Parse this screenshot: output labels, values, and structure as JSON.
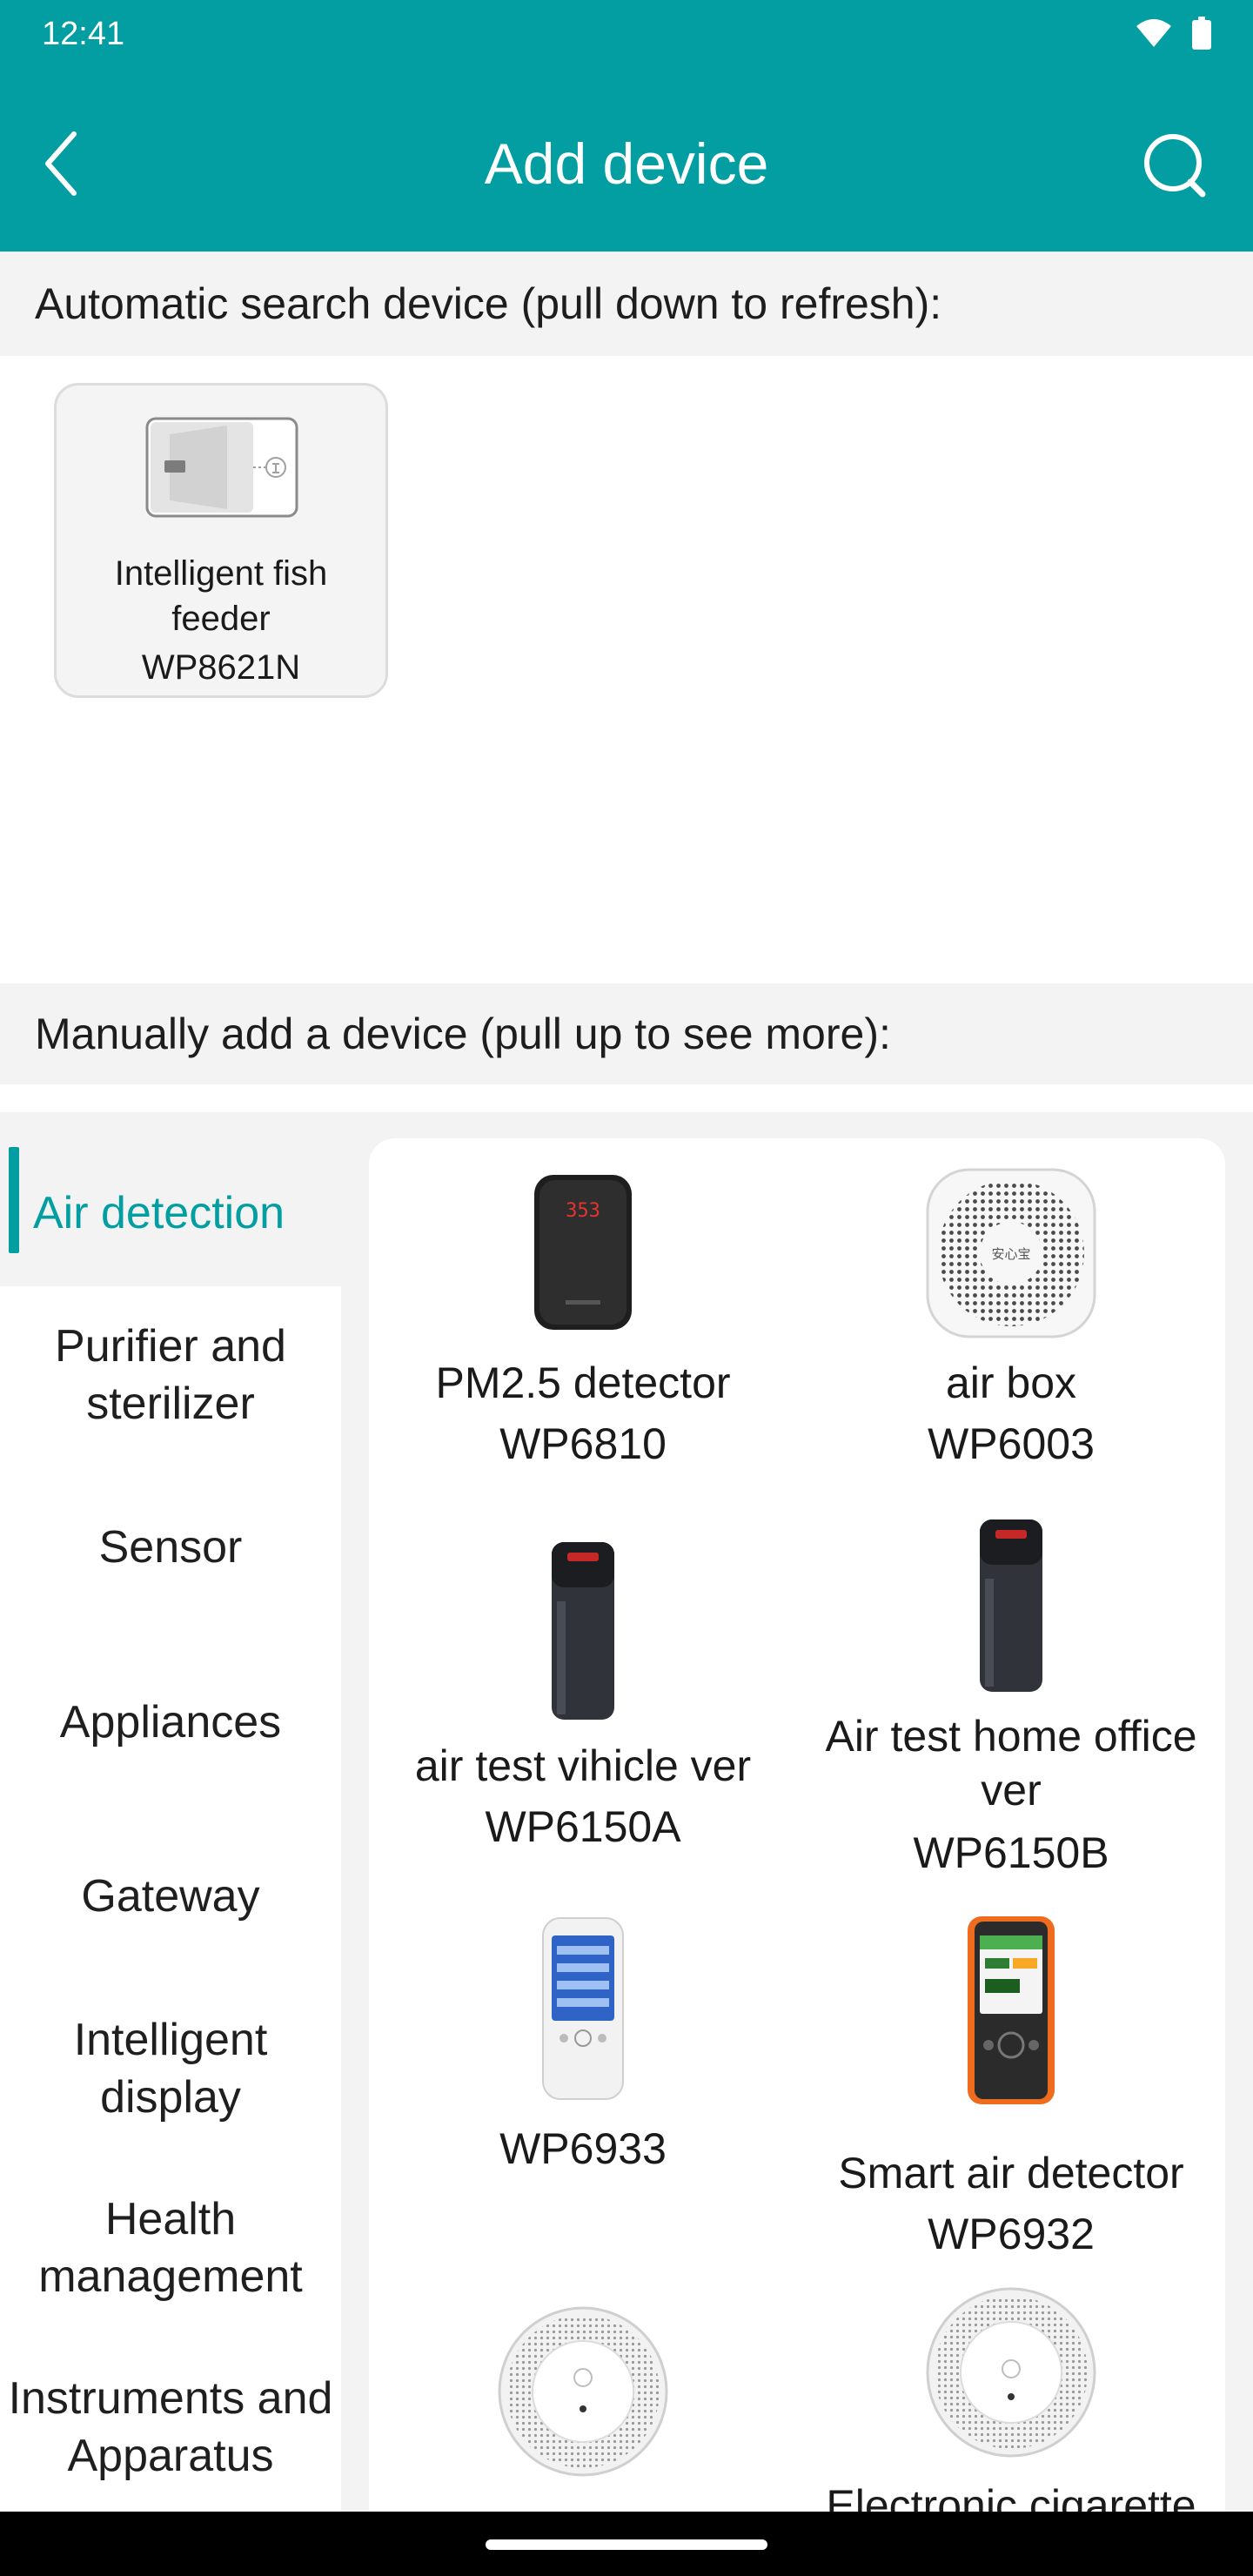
{
  "status_bar": {
    "time": "12:41"
  },
  "header": {
    "title": "Add device"
  },
  "auto_section": {
    "heading": "Automatic search device (pull down to refresh):",
    "devices": [
      {
        "name": "Intelligent fish feeder",
        "model": "WP8621N"
      }
    ]
  },
  "manual_section": {
    "heading": "Manually add a device (pull up to see more):",
    "categories": [
      {
        "label": "Air detection",
        "active": true
      },
      {
        "label": "Purifier and sterilizer"
      },
      {
        "label": "Sensor"
      },
      {
        "label": "Appliances"
      },
      {
        "label": "Gateway"
      },
      {
        "label": "Intelligent display"
      },
      {
        "label": "Health management"
      },
      {
        "label": "Instruments and Apparatus"
      }
    ],
    "products": [
      {
        "name": "PM2.5 detector",
        "model": "WP6810",
        "icon": "pm25-detector-image"
      },
      {
        "name": "air box",
        "model": "WP6003",
        "icon": "air-box-image"
      },
      {
        "name": "air test vihicle ver",
        "model": "WP6150A",
        "icon": "air-test-vehicle-image"
      },
      {
        "name": "Air test home office ver",
        "model": "WP6150B",
        "icon": "air-test-home-office-image"
      },
      {
        "name": "",
        "model": "WP6933",
        "icon": "wp6933-image"
      },
      {
        "name": "Smart air detector",
        "model": "WP6932",
        "icon": "smart-air-detector-image"
      },
      {
        "name": "",
        "model": "",
        "icon": "round-detector-image"
      },
      {
        "name": "Electronic cigarette",
        "model": "",
        "icon": "electronic-cigarette-detector-image"
      }
    ]
  },
  "colors": {
    "accent": "#029ea1",
    "section_bg": "#f3f3f3",
    "text": "#1a1a1a"
  }
}
